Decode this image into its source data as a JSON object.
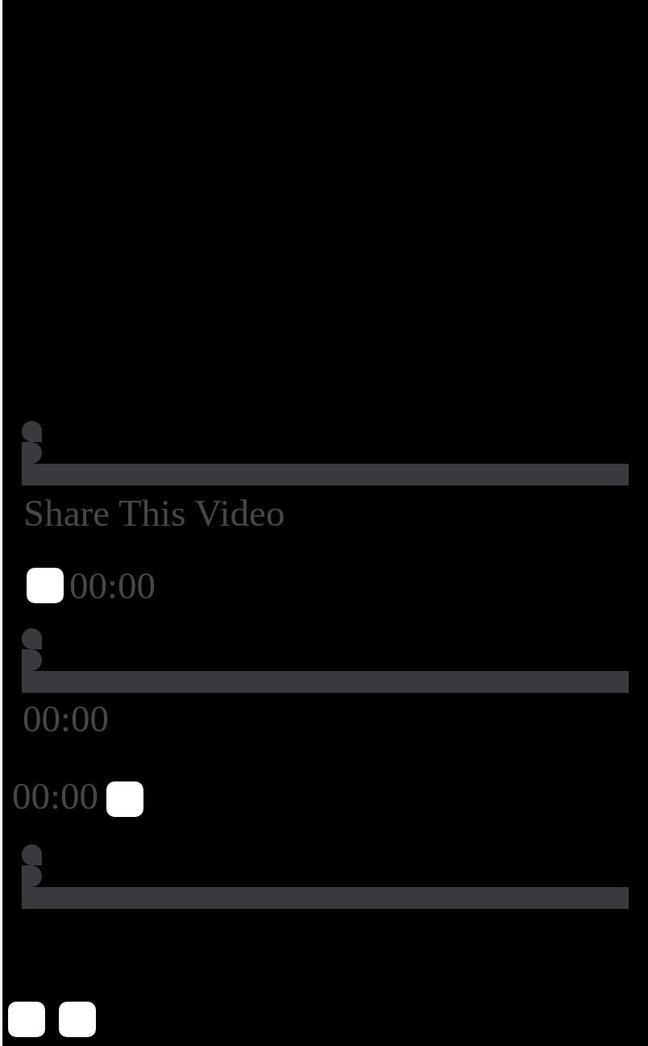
{
  "progress_slider": {
    "level": 0
  },
  "share_heading": "Share This Video",
  "current_time": "00:00",
  "seek_slider": {
    "level": 0
  },
  "elapsed_time": "00:00",
  "remaining_time": "00:00",
  "volume_slider": {
    "level": 0
  }
}
